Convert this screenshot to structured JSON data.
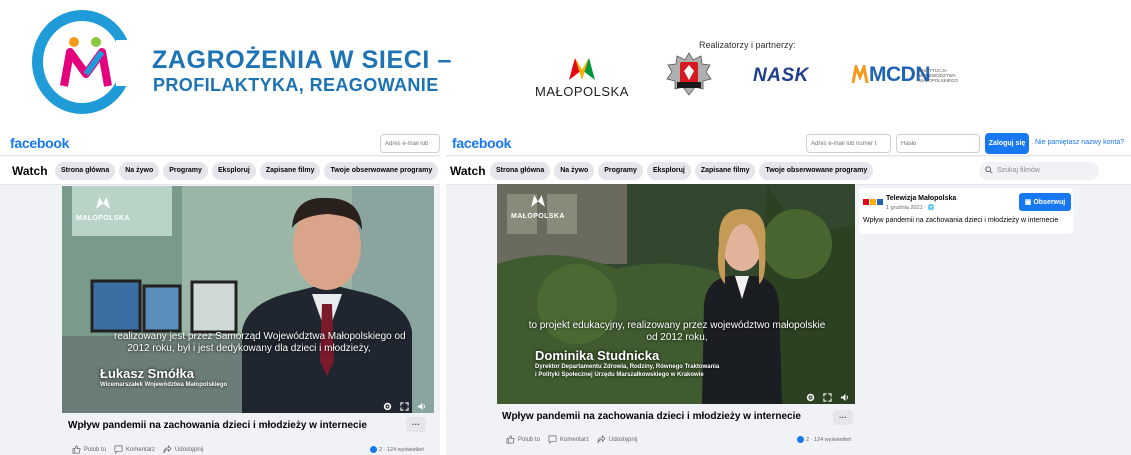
{
  "banner": {
    "title": "ZAGROŻENIA W SIECI –",
    "subtitle": "PROFILAKTYKA, REAGOWANIE",
    "partners_label": "Realizatorzy i partnerzy:",
    "malopolska": "MAŁOPOLSKA",
    "nask": "NASK",
    "mcdn": "MCDN",
    "mcdn_small": "INSTYTUCJA WOJEWÓDZTWA MAŁOPOLSKIEGO",
    "brand_color": "#1d73b4"
  },
  "left": {
    "logo": "facebook",
    "email_placeholder": "Adres e-mail lub",
    "watch": "Watch",
    "tabs": [
      "Strona główna",
      "Na żywo",
      "Programy",
      "Eksploruj",
      "Zapisane filmy",
      "Twoje obserwowane programy"
    ],
    "video_brand": "MAŁOPOLSKA",
    "caption_1": "realizowany jest przez Samorząd Województwa Małopolskiego od",
    "caption_2": "2012 roku, był i jest dedykowany dla dzieci i młodzieży,",
    "person_name": "Łukasz Smółka",
    "person_role": "Wicemarszałek Województwa Małopolskiego",
    "post_title": "Wpływ pandemii na zachowania dzieci i młodzieży w internecie",
    "more": "···",
    "actions": [
      "Polub to",
      "Komentarz",
      "Udostępnij"
    ],
    "views": "2 · 124 wyświetleń"
  },
  "right": {
    "logo": "facebook",
    "email_placeholder": "Adres e-mail lub numer t",
    "password_placeholder": "Hasło",
    "login_button": "Zaloguj się",
    "forgot": "Nie pamiętasz nazwy konta?",
    "watch": "Watch",
    "tabs": [
      "Strona główna",
      "Na żywo",
      "Programy",
      "Eksploruj",
      "Zapisane filmy",
      "Twoje obserwowane programy"
    ],
    "search_placeholder": "Szukaj filmów",
    "video_brand": "MAŁOPOLSKA",
    "caption_1": "to projekt edukacyjny, realizowany przez województwo małopolskie",
    "caption_2": "od 2012 roku,",
    "person_name": "Dominika Studnicka",
    "person_role_1": "Dyrektor Departamentu Zdrowia, Rodziny, Równego Traktowania",
    "person_role_2": "i Polityki Społecznej Urzędu Marszałkowskiego w Krakowie",
    "post_title": "Wpływ pandemii na zachowania dzieci i młodzieży w internecie",
    "more": "···",
    "actions": [
      "Polub to",
      "Komentarz",
      "Udostępnij"
    ],
    "views": "2 · 124 wyświetleń",
    "channel_name": "Telewizja Małopolska",
    "channel_date": "1 grudnia 2021 · 🌐",
    "follow_button": "Obserwuj",
    "side_title": "Wpływ pandemii na zachowania dzieci i młodzieży w internecie"
  },
  "colors": {
    "facebook_blue": "#1877f2",
    "background": "#f0f2f5"
  }
}
